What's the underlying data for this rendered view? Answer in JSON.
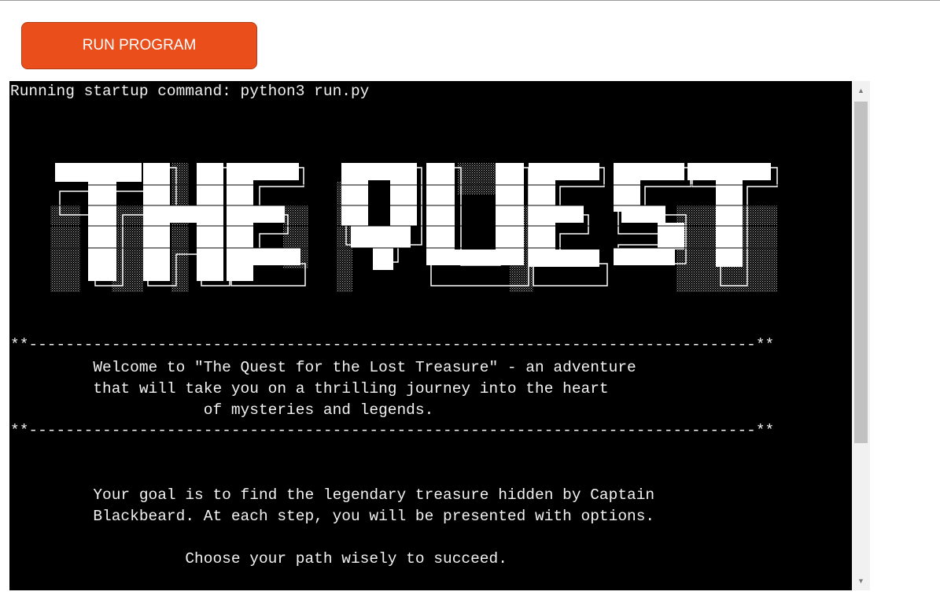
{
  "run_button": {
    "label": "RUN PROGRAM"
  },
  "terminal": {
    "startup_line": "Running startup command: python3 run.py",
    "banner_alt": "THE QUEST",
    "divider_top": "**-------------------------------------------------------------------------------**",
    "welcome_lines": [
      "         Welcome to \"The Quest for the Lost Treasure\" - an adventure",
      "         that will take you on a thrilling journey into the heart",
      "                     of mysteries and legends."
    ],
    "divider_bottom": "**-------------------------------------------------------------------------------**",
    "goal_lines": [
      "         Your goal is to find the legendary treasure hidden by Captain",
      "         Blackbeard. At each step, you will be presented with options."
    ],
    "choose_line": "                   Choose your path wisely to succeed."
  },
  "scrollbar": {
    "up_icon": "triangle-up",
    "down_icon": "triangle-down"
  },
  "colors": {
    "button_bg": "#e94e1b",
    "terminal_bg": "#000000",
    "terminal_text": "#f2f2f2",
    "scrollbar_track": "#f1f1f1",
    "scrollbar_thumb": "#c1c1c1"
  }
}
